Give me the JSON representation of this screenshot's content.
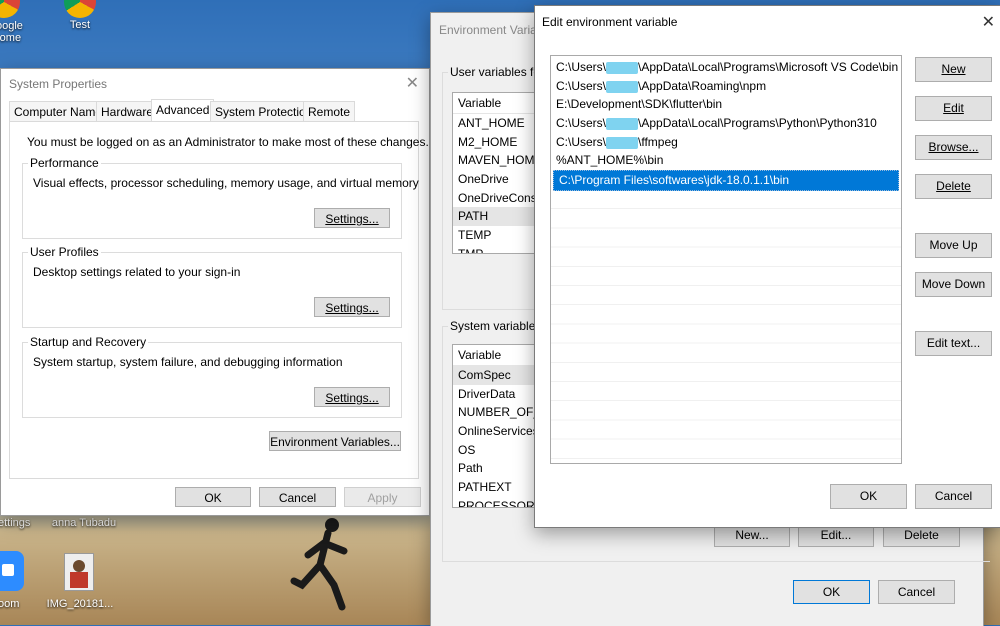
{
  "desktop": {
    "icons": [
      {
        "label": "oogle\nrome"
      },
      {
        "label": "Test"
      },
      {
        "label": "ettings"
      },
      {
        "label": "anna Tubadu"
      },
      {
        "label": "oom"
      },
      {
        "label": "IMG_20181..."
      }
    ]
  },
  "sysprops": {
    "title": "System Properties",
    "tabs": [
      "Computer Name",
      "Hardware",
      "Advanced",
      "System Protection",
      "Remote"
    ],
    "active_tab": "Advanced",
    "admin_note": "You must be logged on as an Administrator to make most of these changes.",
    "performance": {
      "title": "Performance",
      "desc": "Visual effects, processor scheduling, memory usage, and virtual memory",
      "button": "Settings..."
    },
    "profiles": {
      "title": "User Profiles",
      "desc": "Desktop settings related to your sign-in",
      "button": "Settings..."
    },
    "startup": {
      "title": "Startup and Recovery",
      "desc": "System startup, system failure, and debugging information",
      "button": "Settings..."
    },
    "env_button": "Environment Variables...",
    "ok": "OK",
    "cancel": "Cancel",
    "apply": "Apply"
  },
  "envvars": {
    "title": "Environment Varia",
    "user_group": "User variables fo",
    "user_header": "Variable",
    "user_vars": [
      "ANT_HOME",
      "M2_HOME",
      "MAVEN_HOME",
      "OneDrive",
      "OneDriveConsu",
      "PATH",
      "TEMP",
      "TMP"
    ],
    "system_group": "System variables",
    "system_header": "Variable",
    "system_vars": [
      "ComSpec",
      "DriverData",
      "NUMBER_OF_P",
      "OnlineServices",
      "OS",
      "Path",
      "PATHEXT",
      "PROCESSOR"
    ],
    "new": "New...",
    "edit": "Edit...",
    "delete": "Delete",
    "ok": "OK",
    "cancel": "Cancel"
  },
  "editenv": {
    "title": "Edit environment variable",
    "entries": [
      {
        "pre": "C:\\Users\\",
        "post": "\\AppData\\Local\\Programs\\Microsoft VS Code\\bin",
        "redacted": true
      },
      {
        "pre": "C:\\Users\\",
        "post": "\\AppData\\Roaming\\npm",
        "redacted": true
      },
      {
        "pre": "E:\\Development\\SDK\\flutter\\bin",
        "post": "",
        "redacted": false
      },
      {
        "pre": "C:\\Users\\",
        "post": "\\AppData\\Local\\Programs\\Python\\Python310",
        "redacted": true
      },
      {
        "pre": "C:\\Users\\",
        "post": "\\ffmpeg",
        "redacted": true
      },
      {
        "pre": "%ANT_HOME%\\bin",
        "post": "",
        "redacted": false
      },
      {
        "pre": "C:\\Program Files\\softwares\\jdk-18.0.1.1\\bin",
        "post": "",
        "redacted": false
      }
    ],
    "selected_index": 6,
    "buttons": {
      "new": "New",
      "edit": "Edit",
      "browse": "Browse...",
      "delete": "Delete",
      "move_up": "Move Up",
      "move_down": "Move Down",
      "edit_text": "Edit text..."
    },
    "ok": "OK",
    "cancel": "Cancel",
    "colors": {
      "selection": "#0078d7",
      "redaction": "#7fd3f0"
    }
  }
}
